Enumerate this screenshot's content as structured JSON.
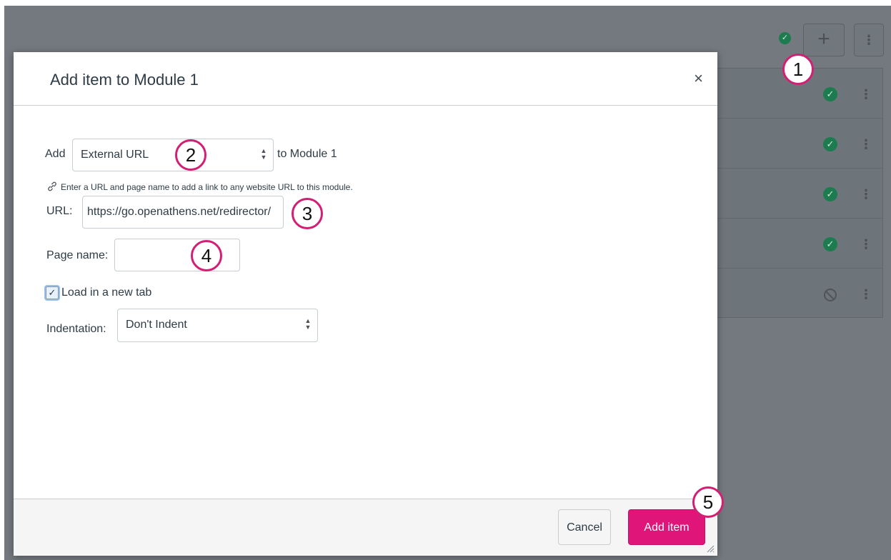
{
  "modal": {
    "title": "Add item to Module 1",
    "close_glyph": "×"
  },
  "form": {
    "add_label": "Add",
    "item_type": "External URL",
    "to_module_label": "to Module 1",
    "hint": "Enter a URL and page name to add a link to any website URL to this module.",
    "url_label": "URL:",
    "url_value": "https://go.openathens.net/redirector/",
    "page_name_label": "Page name:",
    "page_name_value": "",
    "new_tab_label": "Load in a new tab",
    "new_tab_checked": true,
    "indentation_label": "Indentation:",
    "indentation_value": "Don't Indent"
  },
  "footer": {
    "cancel_label": "Cancel",
    "add_item_label": "Add item"
  },
  "callouts": [
    "1",
    "2",
    "3",
    "4",
    "5"
  ],
  "background": {
    "plus_glyph": "+",
    "kebab_glyph": "⋮",
    "check_glyph": "✓",
    "rows": [
      {
        "status": "published"
      },
      {
        "status": "published"
      },
      {
        "status": "published"
      },
      {
        "status": "published"
      },
      {
        "status": "unpublished"
      }
    ]
  },
  "colors": {
    "accent": "#e0157a",
    "callout_ring": "#d21f74",
    "published_green": "#1c7b4f",
    "overlay": "#73797e"
  },
  "icons": {
    "link": "link-icon",
    "close": "close-icon",
    "select_arrows": "updown-arrows-icon",
    "resize": "resize-grip-icon"
  }
}
